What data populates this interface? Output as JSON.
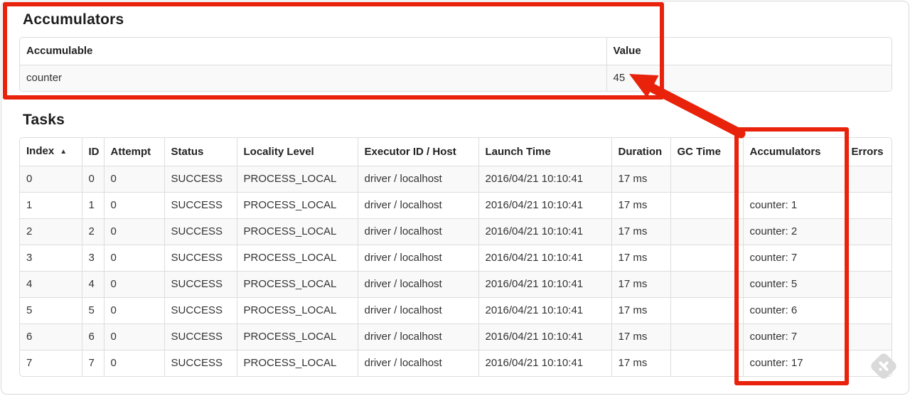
{
  "colors": {
    "annotation_red": "#e8220b",
    "row_stripe": "#f9f9f9",
    "table_border": "#dddddd"
  },
  "accumulators_section": {
    "heading": "Accumulators",
    "table": {
      "headers": {
        "accumulable": "Accumulable",
        "value": "Value"
      },
      "rows": [
        {
          "accumulable": "counter",
          "value": "45"
        }
      ]
    }
  },
  "tasks_section": {
    "heading": "Tasks",
    "table": {
      "headers": {
        "index": "Index",
        "id": "ID",
        "attempt": "Attempt",
        "status": "Status",
        "locality": "Locality Level",
        "executor": "Executor ID / Host",
        "launch": "Launch Time",
        "duration": "Duration",
        "gc": "GC Time",
        "accumulators": "Accumulators",
        "errors": "Errors"
      },
      "sort_arrow": "▲",
      "rows": [
        {
          "index": "0",
          "id": "0",
          "attempt": "0",
          "status": "SUCCESS",
          "locality": "PROCESS_LOCAL",
          "executor": "driver / localhost",
          "launch": "2016/04/21 10:10:41",
          "duration": "17 ms",
          "gc": "",
          "accumulators": "",
          "errors": ""
        },
        {
          "index": "1",
          "id": "1",
          "attempt": "0",
          "status": "SUCCESS",
          "locality": "PROCESS_LOCAL",
          "executor": "driver / localhost",
          "launch": "2016/04/21 10:10:41",
          "duration": "17 ms",
          "gc": "",
          "accumulators": "counter: 1",
          "errors": ""
        },
        {
          "index": "2",
          "id": "2",
          "attempt": "0",
          "status": "SUCCESS",
          "locality": "PROCESS_LOCAL",
          "executor": "driver / localhost",
          "launch": "2016/04/21 10:10:41",
          "duration": "17 ms",
          "gc": "",
          "accumulators": "counter: 2",
          "errors": ""
        },
        {
          "index": "3",
          "id": "3",
          "attempt": "0",
          "status": "SUCCESS",
          "locality": "PROCESS_LOCAL",
          "executor": "driver / localhost",
          "launch": "2016/04/21 10:10:41",
          "duration": "17 ms",
          "gc": "",
          "accumulators": "counter: 7",
          "errors": ""
        },
        {
          "index": "4",
          "id": "4",
          "attempt": "0",
          "status": "SUCCESS",
          "locality": "PROCESS_LOCAL",
          "executor": "driver / localhost",
          "launch": "2016/04/21 10:10:41",
          "duration": "17 ms",
          "gc": "",
          "accumulators": "counter: 5",
          "errors": ""
        },
        {
          "index": "5",
          "id": "5",
          "attempt": "0",
          "status": "SUCCESS",
          "locality": "PROCESS_LOCAL",
          "executor": "driver / localhost",
          "launch": "2016/04/21 10:10:41",
          "duration": "17 ms",
          "gc": "",
          "accumulators": "counter: 6",
          "errors": ""
        },
        {
          "index": "6",
          "id": "6",
          "attempt": "0",
          "status": "SUCCESS",
          "locality": "PROCESS_LOCAL",
          "executor": "driver / localhost",
          "launch": "2016/04/21 10:10:41",
          "duration": "17 ms",
          "gc": "",
          "accumulators": "counter: 7",
          "errors": ""
        },
        {
          "index": "7",
          "id": "7",
          "attempt": "0",
          "status": "SUCCESS",
          "locality": "PROCESS_LOCAL",
          "executor": "driver / localhost",
          "launch": "2016/04/21 10:10:41",
          "duration": "17 ms",
          "gc": "",
          "accumulators": "counter: 17",
          "errors": ""
        }
      ]
    }
  }
}
